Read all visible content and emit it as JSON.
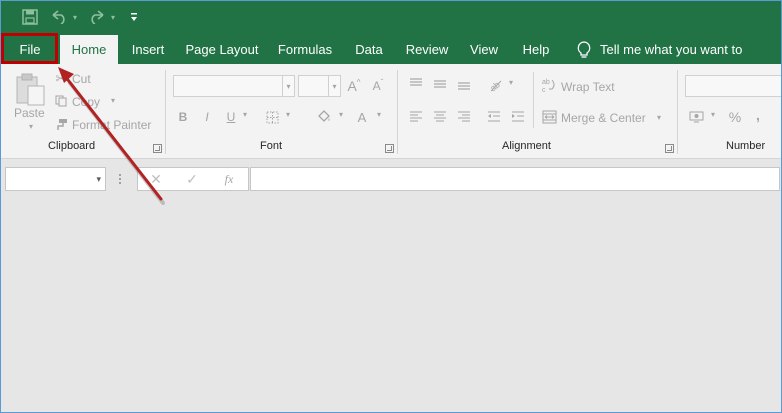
{
  "tabs": [
    {
      "label": "File"
    },
    {
      "label": "Home"
    },
    {
      "label": "Insert"
    },
    {
      "label": "Page Layout"
    },
    {
      "label": "Formulas"
    },
    {
      "label": "Data"
    },
    {
      "label": "Review"
    },
    {
      "label": "View"
    },
    {
      "label": "Help"
    }
  ],
  "tell_me": "Tell me what you want to do",
  "clipboard": {
    "paste": "Paste",
    "cut": "Cut",
    "copy": "Copy",
    "format_painter": "Format Painter",
    "label": "Clipboard"
  },
  "font": {
    "label": "Font",
    "bold": "B",
    "italic": "I",
    "underline": "U"
  },
  "alignment": {
    "label": "Alignment",
    "wrap_text": "Wrap Text",
    "merge_center": "Merge & Center"
  },
  "number": {
    "label": "Number",
    "percent": "%",
    "comma": ","
  },
  "formula_bar": {
    "fx": "fx"
  },
  "colors": {
    "excel_green": "#217346",
    "highlight_red": "#c00000",
    "arrow": "#b22222"
  }
}
